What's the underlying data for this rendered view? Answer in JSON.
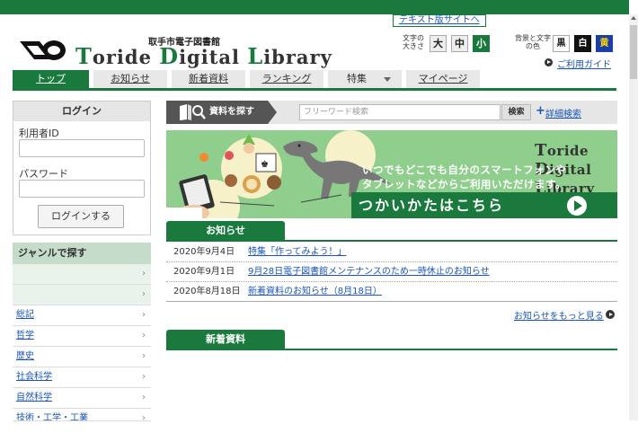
{
  "header": {
    "text_version_link": "テキスト版サイトへ",
    "library_name_small": "取手市電子図書館",
    "title_parts": [
      {
        "cap": "T",
        "rest": "oride "
      },
      {
        "cap": "D",
        "rest": "igital "
      },
      {
        "cap": "L",
        "rest": "ibrary"
      }
    ],
    "font_size_label": "文字の大きさ",
    "font_sizes": [
      "大",
      "中",
      "小"
    ],
    "bg_color_label": "背景と文字の色",
    "bg_options": [
      "黒",
      "白",
      "黄"
    ],
    "guide_link": "ご利用ガイド"
  },
  "nav": {
    "tabs": [
      "トップ",
      "お知らせ",
      "新着資料",
      "ランキング",
      "特集",
      "マイページ"
    ],
    "feature_dropdown_icon": "triangle-down"
  },
  "login": {
    "title": "ログイン",
    "user_id_label": "利用者ID",
    "password_label": "パスワード",
    "button": "ログインする"
  },
  "genre": {
    "title": "ジャンルで探す",
    "items": [
      "",
      "",
      "総記",
      "哲学",
      "歴史",
      "社会科学",
      "自然科学",
      "技術・工学・工業"
    ]
  },
  "search": {
    "label": "資料を探す",
    "placeholder": "フリーワード検索",
    "button": "検索",
    "advanced": "詳細検索",
    "plus": "+"
  },
  "banner": {
    "title_parts": [
      {
        "cap": "T",
        "rest": "oride "
      },
      {
        "cap": "D",
        "rest": "igital "
      },
      {
        "cap": "L",
        "rest": "ibrary"
      }
    ],
    "line1": "いつでもどこでも自分のスマートフォンや",
    "line2": "タブレットなどからご利用いただけます。",
    "cta": "つかいかたはこちら"
  },
  "news": {
    "title": "お知らせ",
    "items": [
      {
        "date": "2020年9月4日",
        "text": "特集「作ってみよう！」"
      },
      {
        "date": "2020年9月1日",
        "text": "9月28日電子図書館メンテナンスのため一時休止のお知らせ"
      },
      {
        "date": "2020年8月18日",
        "text": "新着資料のお知らせ（8月18日）"
      }
    ],
    "more": "お知らせをもっと見る"
  },
  "new_materials": {
    "title": "新着資料"
  },
  "colors": {
    "brand_green": "#1a7a3e",
    "banner_green": "#8fce8d",
    "link_blue": "#1a56b8"
  }
}
